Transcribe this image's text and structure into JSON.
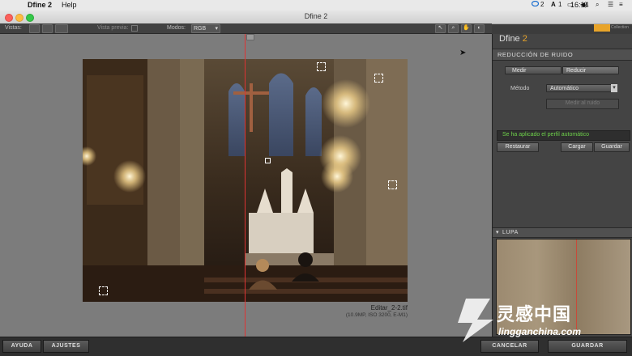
{
  "menubar": {
    "apple_glyph": "",
    "app_name": "Dfine 2",
    "help": "Help",
    "status_icon_count": "2",
    "adobe_badge": "1",
    "clock": "16:14"
  },
  "window": {
    "title": "Dfine 2"
  },
  "toolbar": {
    "vistas_label": "Vistas:",
    "preview_label": "Vista previa:",
    "modes_label": "Modos:",
    "mode_value": "RGB"
  },
  "image": {
    "filename": "Editar_2-2.tif",
    "info": "(10.9MP, ISO 3200, E-M1)"
  },
  "panel": {
    "brand": "Dfine",
    "brand_version": "2",
    "collection_badge": "Collection",
    "section_title": "REDUCCIÓN DE RUIDO",
    "measure_tab": "Medir",
    "reduce_tab": "Reducir",
    "method_label": "Método",
    "method_value": "Automático",
    "manual_button": "Medir al ruido",
    "status_message": "Se ha aplicado el perfil automático",
    "restore_button": "Restaurar",
    "load_button": "Cargar",
    "save_button": "Guardar",
    "loupe_title": "LUPA"
  },
  "bottom": {
    "help_button": "AYUDA",
    "settings_button": "AJUSTES",
    "cancel_button": "CANCELAR",
    "ok_button": "GUARDAR"
  },
  "watermark": {
    "brand_cn": "灵感中国",
    "url": "lingganchina.com"
  },
  "colors": {
    "split_line": "#dd3333",
    "status_green": "#6ed24a",
    "accent_orange": "#e8a42a"
  }
}
